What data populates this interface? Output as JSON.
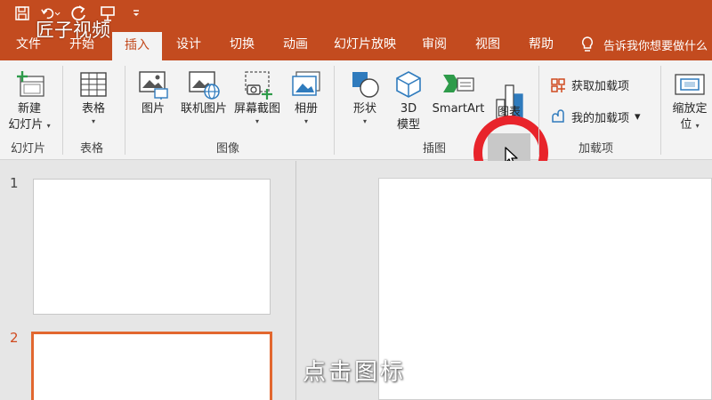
{
  "colors": {
    "accent": "#c34b1f",
    "ribbon_bg": "#f3f3f3",
    "highlight_circle": "#e8242b"
  },
  "watermark": "匠子视频",
  "tabs": [
    {
      "label": "文件"
    },
    {
      "label": "开始"
    },
    {
      "label": "插入"
    },
    {
      "label": "设计"
    },
    {
      "label": "切换"
    },
    {
      "label": "动画"
    },
    {
      "label": "幻灯片放映"
    },
    {
      "label": "审阅"
    },
    {
      "label": "视图"
    },
    {
      "label": "帮助"
    }
  ],
  "tell_me": {
    "text": "告诉我你想要做什么",
    "icon": "lightbulb-icon"
  },
  "ribbon": {
    "slides_group": {
      "label": "幻灯片",
      "new_slide_line1": "新建",
      "new_slide_line2": "幻灯片"
    },
    "table_group": {
      "label": "表格",
      "table": "表格"
    },
    "images_group": {
      "label": "图像",
      "picture": "图片",
      "online_picture": "联机图片",
      "screenshot": "屏幕截图",
      "album": "相册"
    },
    "illustrations_group": {
      "label": "插图",
      "shapes": "形状",
      "model_3d_line1": "3D",
      "model_3d_line2": "模型",
      "smartart": "SmartArt",
      "chart": "图表"
    },
    "addins_group": {
      "label": "加载项",
      "get_addins": "获取加载项",
      "my_addins": "我的加载项"
    },
    "zoom": {
      "line1": "缩放定",
      "line2": "位"
    }
  },
  "slides": [
    {
      "number": "1"
    },
    {
      "number": "2"
    }
  ],
  "subtitle": "点击图标"
}
